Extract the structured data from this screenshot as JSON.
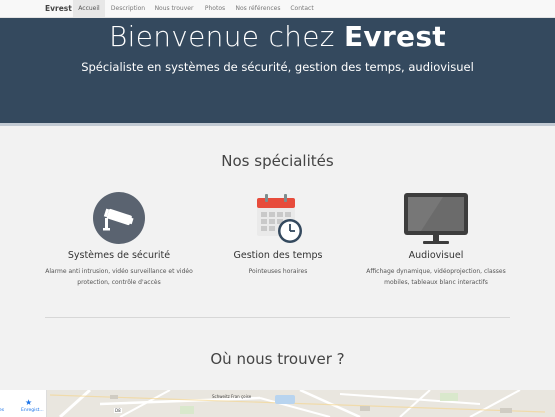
{
  "navbar": {
    "brand": "Evrest",
    "items": [
      {
        "label": "Accueil",
        "active": true
      },
      {
        "label": "Description"
      },
      {
        "label": "Nous trouver"
      },
      {
        "label": "Photos"
      },
      {
        "label": "Nos références"
      },
      {
        "label": "Contact"
      }
    ]
  },
  "hero": {
    "title_prefix": "Bienvenue chez",
    "title_brand": "Evrest",
    "subtitle": "Spécialiste en systèmes de sécurité, gestion des temps, audiovisuel"
  },
  "specialties": {
    "heading": "Nos spécialités",
    "items": [
      {
        "icon": "security-camera-icon",
        "name": "Systèmes de sécurité",
        "description": "Alarme anti intrusion, vidéo surveillance et vidéo protection, contrôle d'accès"
      },
      {
        "icon": "calendar-clock-icon",
        "name": "Gestion des temps",
        "description": "Pointeuses horaires"
      },
      {
        "icon": "monitor-icon",
        "name": "Audiovisuel",
        "description": "Affichage dynamique, vidéoprojection, classes mobiles, tableaux blanc interactifs"
      }
    ]
  },
  "location": {
    "heading": "Où nous trouver ?",
    "map_panel": {
      "left_label": "ires",
      "save_label": "Enregist..."
    },
    "map_labels": [
      "Schweitz Fran çoise",
      "D8"
    ]
  },
  "colors": {
    "hero_bg": "#34495e",
    "page_bg": "#f2f2f2",
    "icon_circle": "#5a6370",
    "calendar_red": "#e74c3c"
  }
}
